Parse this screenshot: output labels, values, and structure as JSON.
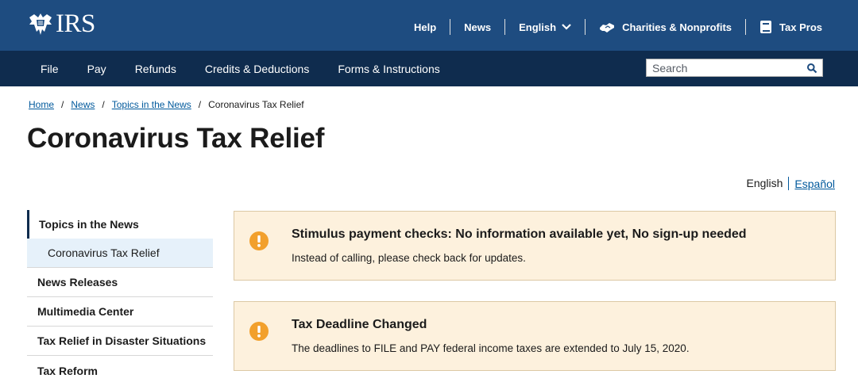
{
  "header": {
    "logo_text": "IRS",
    "utility_links": [
      {
        "label": "Help"
      },
      {
        "label": "News"
      },
      {
        "label": "English"
      },
      {
        "label": "Charities & Nonprofits",
        "icon": "handshake-icon"
      },
      {
        "label": "Tax Pros",
        "icon": "book-icon"
      }
    ]
  },
  "main_nav": {
    "items": [
      "File",
      "Pay",
      "Refunds",
      "Credits & Deductions",
      "Forms & Instructions"
    ],
    "search_placeholder": "Search"
  },
  "breadcrumb": {
    "links": [
      "Home",
      "News",
      "Topics in the News"
    ],
    "separator": "/",
    "current": "Coronavirus Tax Relief"
  },
  "page": {
    "title": "Coronavirus Tax Relief"
  },
  "language": {
    "current": "English",
    "alternate": "Español"
  },
  "sidebar": {
    "heading": "Topics in the News",
    "active_sub": "Coronavirus Tax Relief",
    "items": [
      "News Releases",
      "Multimedia Center",
      "Tax Relief in Disaster Situations",
      "Tax Reform"
    ]
  },
  "alerts": [
    {
      "icon": "exclamation-icon",
      "title": "Stimulus payment checks: No information available yet, No sign-up needed",
      "body": "Instead of calling, please check back for updates."
    },
    {
      "icon": "exclamation-icon",
      "title": "Tax Deadline Changed",
      "body": "The deadlines to FILE and PAY federal income taxes are extended to July 15, 2020."
    }
  ],
  "colors": {
    "header_bg": "#1e4c80",
    "nav_bg": "#0f2c4e",
    "link": "#00599c",
    "alert_bg": "#fdf1dd",
    "alert_icon": "#f2a02c"
  }
}
